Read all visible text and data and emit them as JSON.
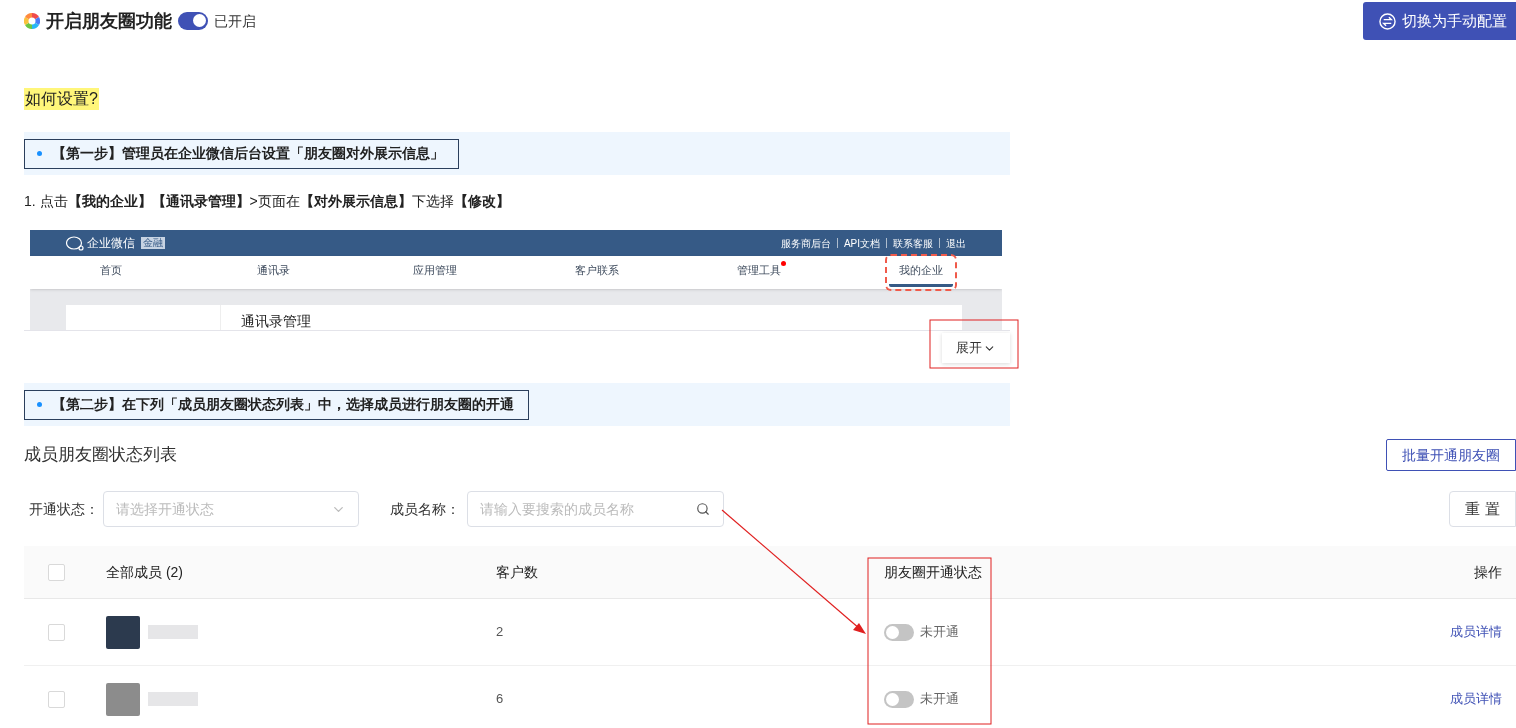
{
  "header": {
    "title": "开启朋友圈功能",
    "enabled": true,
    "status": "已开启",
    "switch_button": "切换为手动配置"
  },
  "guide": {
    "heading": "如何设置?",
    "step1": {
      "title": "【第一步】管理员在企业微信后台设置「朋友圈对外展示信息」",
      "instruction": "1. 点击**【我的企业】【通讯录管理】**>页面在**【对外展示信息】**下选择**【修改】**"
    },
    "preview": {
      "brand": "企业微信",
      "badge": "金融",
      "links": [
        "服务商后台",
        "API文档",
        "联系客服",
        "退出"
      ],
      "nav": [
        {
          "label": "首页",
          "selected": false,
          "dot": false
        },
        {
          "label": "通讯录",
          "selected": false,
          "dot": false
        },
        {
          "label": "应用管理",
          "selected": false,
          "dot": false
        },
        {
          "label": "客户联系",
          "selected": false,
          "dot": false
        },
        {
          "label": "管理工具",
          "selected": false,
          "dot": true
        },
        {
          "label": "我的企业",
          "selected": true,
          "dot": false
        }
      ],
      "panel_title": "通讯录管理"
    },
    "expand_button": "展开",
    "step2": {
      "title": "【第二步】在下列「成员朋友圈状态列表」中，选择成员进行朋友圈的开通"
    }
  },
  "members": {
    "title": "成员朋友圈状态列表",
    "batch_button": "批量开通朋友圈",
    "filters": [
      {
        "kind": "select",
        "label": "开通状态：",
        "placeholder": "请选择开通状态"
      },
      {
        "kind": "search",
        "label": "成员名称：",
        "placeholder": "请输入要搜索的成员名称"
      }
    ],
    "reset_button": "重 置",
    "select_all": {
      "checked": false
    },
    "columns": [
      "全部成员 (2)",
      "客户数",
      "朋友圈开通状态",
      "操作"
    ],
    "rows": [
      {
        "checked": false,
        "customers": "2",
        "on": false,
        "status": "未开通",
        "action": "成员详情"
      },
      {
        "checked": false,
        "customers": "6",
        "on": false,
        "status": "未开通",
        "action": "成员详情"
      }
    ]
  }
}
